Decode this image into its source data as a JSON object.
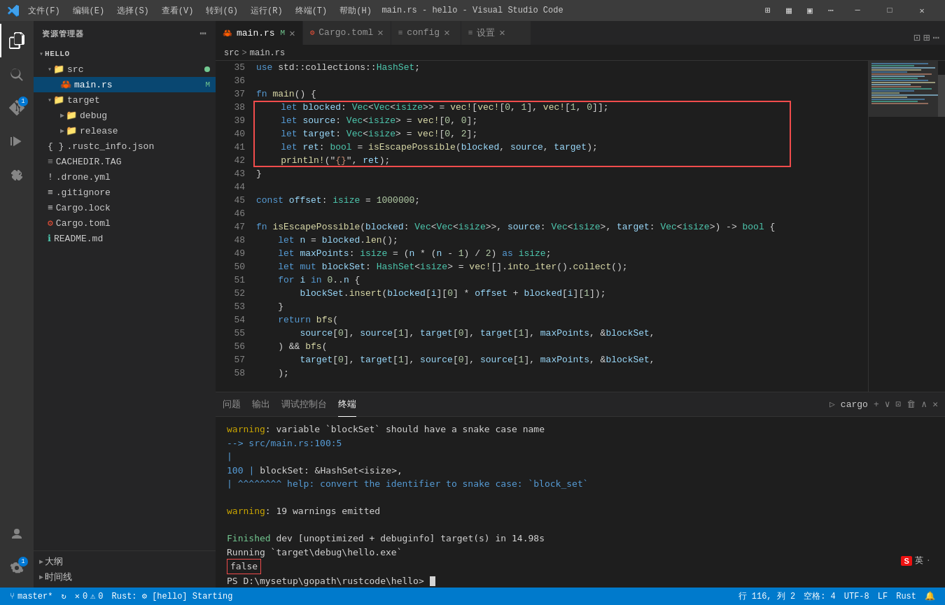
{
  "titleBar": {
    "title": "main.rs - hello - Visual Studio Code",
    "menus": [
      "文件(F)",
      "编辑(E)",
      "选择(S)",
      "查看(V)",
      "转到(G)",
      "运行(R)",
      "终端(T)",
      "帮助(H)"
    ]
  },
  "sidebar": {
    "header": "资源管理器",
    "hello": {
      "label": "HELLO",
      "src": {
        "label": "src",
        "files": [
          {
            "name": "main.rs",
            "badge": "M",
            "active": true
          }
        ]
      },
      "target": {
        "label": "target",
        "children": [
          {
            "name": "debug"
          },
          {
            "name": "release"
          }
        ]
      },
      "files": [
        {
          "name": ".rustc_info.json"
        },
        {
          "name": "CACHEDIR.TAG"
        },
        {
          "name": ".drone.yml"
        },
        {
          "name": ".gitignore"
        },
        {
          "name": "Cargo.lock"
        },
        {
          "name": "Cargo.toml"
        },
        {
          "name": "README.md"
        }
      ]
    }
  },
  "tabs": [
    {
      "name": "main.rs",
      "label": "M",
      "active": true,
      "modified": true
    },
    {
      "name": "Cargo.toml",
      "active": false
    },
    {
      "name": "config",
      "active": false
    },
    {
      "name": "设置",
      "active": false
    }
  ],
  "breadcrumb": [
    "src",
    ">",
    "main.rs"
  ],
  "codeLines": [
    {
      "num": 35,
      "code": "use std::collections::HashSet;"
    },
    {
      "num": 36,
      "code": ""
    },
    {
      "num": 37,
      "code": "fn main() {"
    },
    {
      "num": 38,
      "code": "    let blocked: Vec<Vec<isize>> = vec![vec![0, 1], vec![1, 0]];",
      "highlight": true
    },
    {
      "num": 39,
      "code": "    let source: Vec<isize> = vec![0, 0];",
      "highlight": true
    },
    {
      "num": 40,
      "code": "    let target: Vec<isize> = vec![0, 2];",
      "highlight": true
    },
    {
      "num": 41,
      "code": "    let ret: bool = isEscapePossible(blocked, source, target);",
      "highlight": true
    },
    {
      "num": 42,
      "code": "    println!(\"{}\", ret);",
      "highlight": true
    },
    {
      "num": 43,
      "code": "}"
    },
    {
      "num": 44,
      "code": ""
    },
    {
      "num": 45,
      "code": "const offset: isize = 1000000;"
    },
    {
      "num": 46,
      "code": ""
    },
    {
      "num": 47,
      "code": "fn isEscapePossible(blocked: Vec<Vec<isize>>, source: Vec<isize>, target: Vec<isize>) -> bool {"
    },
    {
      "num": 48,
      "code": "    let n = blocked.len();"
    },
    {
      "num": 49,
      "code": "    let maxPoints: isize = (n * (n - 1) / 2) as isize;"
    },
    {
      "num": 50,
      "code": "    let mut blockSet: HashSet<isize> = vec![].into_iter().collect();"
    },
    {
      "num": 51,
      "code": "    for i in 0..n {"
    },
    {
      "num": 52,
      "code": "        blockSet.insert(blocked[i][0] * offset + blocked[i][1]);"
    },
    {
      "num": 53,
      "code": "    }"
    },
    {
      "num": 54,
      "code": "    return bfs("
    },
    {
      "num": 55,
      "code": "        source[0], source[1], target[0], target[1], maxPoints, &blockSet,"
    },
    {
      "num": 56,
      "code": "    ) && bfs("
    },
    {
      "num": 57,
      "code": "        target[0], target[1], source[0], source[1], maxPoints, &blockSet,"
    },
    {
      "num": 58,
      "code": "    );"
    }
  ],
  "panel": {
    "tabs": [
      "问题",
      "输出",
      "调试控制台",
      "终端"
    ],
    "activeTab": "终端",
    "terminalContent": [
      {
        "type": "warning",
        "text": "warning: variable `blockSet` should have a snake case name"
      },
      {
        "type": "normal",
        "text": "   --> src/main.rs:100:5"
      },
      {
        "type": "normal",
        "text": "    |"
      },
      {
        "type": "code",
        "lineNum": "100",
        "text": "        blockSet: &HashSet<isize>,"
      },
      {
        "type": "normal",
        "text": "    |    ^^^^^^^^ help: convert the identifier to snake case: `block_set`"
      },
      {
        "type": "normal",
        "text": ""
      },
      {
        "type": "warning",
        "text": "warning: 19 warnings emitted"
      },
      {
        "type": "normal",
        "text": ""
      },
      {
        "type": "success",
        "text": "    Finished dev [unoptimized + debuginfo] target(s) in 14.98s"
      },
      {
        "type": "normal",
        "text": "     Running `target\\debug\\hello.exe`"
      },
      {
        "type": "false_badge",
        "text": "false"
      },
      {
        "type": "normal",
        "text": "PS D:\\mysetup\\gopath\\rustcode\\hello> "
      }
    ]
  },
  "statusBar": {
    "branch": "master*",
    "sync": "",
    "errors": "0",
    "warnings": "0",
    "rust": "Rust: ⚙ [hello] Starting",
    "position": "行 116, 列 2",
    "spaces": "空格: 4",
    "encoding": "UTF-8",
    "lineEnding": "LF",
    "language": "Rust",
    "notifications": ""
  }
}
